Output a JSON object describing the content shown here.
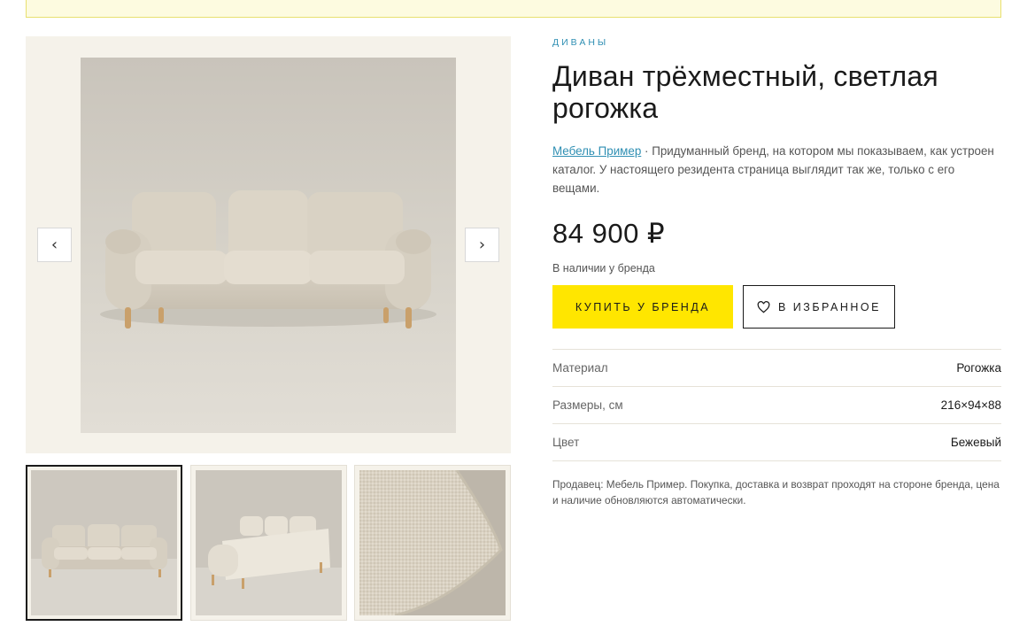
{
  "category": "ДИВАНЫ",
  "title": "Диван трёхместный, светлая рогожка",
  "brand_link": "Мебель Пример",
  "description": " · Придуманный бренд, на котором мы показываем, как устроен каталог. У настоящего резидента страница выглядит так же, только с его вещами.",
  "price": "84 900 ₽",
  "availability": "В наличии у бренда",
  "buttons": {
    "buy": "КУПИТЬ У БРЕНДА",
    "favorite": "В ИЗБРАННОЕ"
  },
  "gallery": {
    "prev_icon": "‹",
    "next_icon": "›",
    "thumbnails": [
      "sofa-front",
      "sofa-back",
      "fabric-closeup"
    ],
    "active_thumbnail": 0
  },
  "specs": [
    {
      "label": "Материал",
      "value": "Рогожка"
    },
    {
      "label": "Размеры, см",
      "value": "216×94×88"
    },
    {
      "label": "Цвет",
      "value": "Бежевый"
    }
  ],
  "seller_note": "Продавец: Мебель Пример. Покупка, доставка и возврат проходят на стороне бренда, цена и наличие обновляются автоматически.",
  "colors": {
    "accent_yellow": "#ffe600",
    "link_blue": "#2f8fb3",
    "gallery_bg": "#f5f2ea"
  }
}
